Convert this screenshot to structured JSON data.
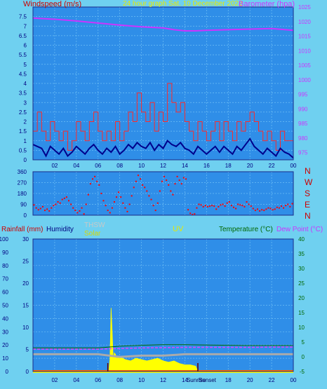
{
  "header": {
    "wind_title": "Windspeed (m/s)",
    "center_title": "24 hour graph Sat. 10 December 2022",
    "baro_title": "Barometer (hpa)"
  },
  "compass": [
    "N",
    "W",
    "S",
    "E",
    "N"
  ],
  "lower_labels": {
    "rain": "Rainfall (mm)",
    "humidity": "Humidity",
    "thsw": "THSW",
    "solar": "Solar",
    "uv": "UV",
    "temp": "Temperature (°C)",
    "dew": "Dew Point (°C)",
    "sunrise": "Sunrise",
    "sunset": "Sunset"
  },
  "colors": {
    "background": "#6fd0f0",
    "plot": "#2f8ee8",
    "grid": "#6fc0f5",
    "gust": "#ff2a2a",
    "wind": "#00008b",
    "barometer": "#cc33ff",
    "solar": "#ffff00",
    "temperature": "#ff0000",
    "dewpoint": "#dd44ff",
    "humidity": "#aaaaaa"
  },
  "chart_data": [
    {
      "type": "line",
      "name": "wind-barometer",
      "title": "24 hour graph Sat. 10 December 2022",
      "x_ticks": [
        "02",
        "04",
        "06",
        "08",
        "10",
        "12",
        "14",
        "16",
        "18",
        "20",
        "22",
        "00"
      ],
      "ylabel": "Windspeed (m/s)",
      "ylim": [
        0,
        8
      ],
      "y_ticks": [
        "0",
        "0.5",
        "1",
        "1.5",
        "2",
        "2.5",
        "3",
        "3.5",
        "4",
        "4.5",
        "5",
        "5.5",
        "6",
        "6.5",
        "7",
        "7.5"
      ],
      "y2label": "Barometer (hpa)",
      "y2lim": [
        972.5,
        1025
      ],
      "y2_ticks": [
        "975",
        "980",
        "985",
        "990",
        "995",
        "1000",
        "1005",
        "1010",
        "1015",
        "1020",
        "1025"
      ],
      "series": [
        {
          "name": "Gust",
          "color": "#ff2a2a",
          "style": "step",
          "x": [
            0.0,
            0.4,
            0.8,
            1.2,
            1.6,
            2.0,
            2.4,
            2.8,
            3.2,
            3.6,
            4.0,
            4.4,
            4.8,
            5.2,
            5.6,
            6.0,
            6.4,
            6.8,
            7.2,
            7.6,
            8.0,
            8.4,
            8.8,
            9.2,
            9.6,
            10.0,
            10.4,
            10.8,
            11.2,
            11.6,
            12.0,
            12.4,
            12.8,
            13.2,
            13.6,
            14.0,
            14.4,
            14.8,
            15.2,
            15.6,
            16.0,
            16.4,
            16.8,
            17.2,
            17.6,
            18.0,
            18.4,
            18.8,
            19.2,
            19.6,
            20.0,
            20.4,
            20.8,
            21.2,
            21.6,
            22.0,
            22.4,
            22.8,
            23.2,
            23.6,
            24.0
          ],
          "y": [
            1.5,
            2.5,
            1.5,
            1.0,
            2.0,
            1.5,
            1.0,
            1.5,
            0.5,
            1.0,
            2.0,
            1.5,
            1.0,
            2.0,
            2.5,
            1.5,
            1.0,
            1.5,
            1.0,
            2.0,
            1.0,
            1.5,
            2.5,
            2.0,
            3.5,
            2.5,
            2.0,
            3.0,
            1.5,
            2.5,
            2.0,
            4.0,
            3.0,
            2.5,
            3.0,
            2.0,
            1.5,
            1.0,
            2.0,
            1.5,
            1.0,
            1.5,
            2.0,
            1.0,
            2.0,
            1.5,
            1.0,
            2.0,
            1.5,
            2.0,
            2.5,
            2.0,
            1.5,
            1.0,
            1.5,
            1.0,
            0.5,
            1.5,
            1.0,
            1.0,
            0.5
          ]
        },
        {
          "name": "Wind",
          "color": "#00008b",
          "style": "line",
          "x": [
            0.0,
            0.4,
            0.8,
            1.2,
            1.6,
            2.0,
            2.4,
            2.8,
            3.2,
            3.6,
            4.0,
            4.4,
            4.8,
            5.2,
            5.6,
            6.0,
            6.4,
            6.8,
            7.2,
            7.6,
            8.0,
            8.4,
            8.8,
            9.2,
            9.6,
            10.0,
            10.4,
            10.8,
            11.2,
            11.6,
            12.0,
            12.4,
            12.8,
            13.2,
            13.6,
            14.0,
            14.4,
            14.8,
            15.2,
            15.6,
            16.0,
            16.4,
            16.8,
            17.2,
            17.6,
            18.0,
            18.4,
            18.8,
            19.2,
            19.6,
            20.0,
            20.4,
            20.8,
            21.2,
            21.6,
            22.0,
            22.4,
            22.8,
            23.2,
            23.6,
            24.0
          ],
          "y": [
            0.8,
            0.7,
            0.6,
            0.2,
            0.7,
            0.5,
            0.3,
            0.6,
            0.2,
            0.4,
            0.7,
            0.5,
            0.3,
            0.6,
            0.8,
            0.5,
            0.3,
            0.6,
            0.4,
            0.7,
            0.3,
            0.5,
            0.8,
            0.6,
            0.9,
            0.7,
            0.6,
            0.9,
            0.5,
            0.8,
            0.6,
            1.0,
            0.8,
            0.7,
            0.9,
            0.6,
            0.5,
            0.3,
            0.7,
            0.5,
            0.3,
            0.5,
            0.7,
            0.4,
            0.7,
            0.5,
            0.3,
            0.7,
            0.5,
            0.8,
            1.1,
            0.7,
            0.5,
            0.3,
            0.6,
            0.4,
            0.2,
            0.6,
            0.4,
            0.3,
            0.1
          ]
        },
        {
          "name": "Barometer",
          "axis": "y2",
          "color": "#cc33ff",
          "style": "line",
          "x": [
            0,
            2,
            4,
            6,
            8,
            10,
            12,
            13,
            14,
            15,
            16,
            18,
            20,
            22,
            24
          ],
          "y": [
            1021.2,
            1020.8,
            1020.2,
            1019.5,
            1018.8,
            1018.2,
            1017.8,
            1017.2,
            1016.8,
            1016.8,
            1017.0,
            1017.2,
            1017.4,
            1017.6,
            1017.0
          ]
        }
      ]
    },
    {
      "type": "scatter",
      "name": "wind-direction",
      "ylim": [
        0,
        360
      ],
      "y_ticks": [
        "0",
        "90",
        "180",
        "270",
        "360"
      ],
      "series": [
        {
          "name": "Direction",
          "color": "#ff0000",
          "x": [
            0.1,
            0.3,
            0.5,
            0.7,
            0.9,
            1.1,
            1.3,
            1.5,
            1.7,
            1.9,
            2.1,
            2.3,
            2.5,
            2.7,
            2.9,
            3.1,
            3.3,
            3.5,
            3.7,
            3.9,
            4.1,
            4.3,
            4.5,
            4.7,
            4.9,
            5.1,
            5.3,
            5.5,
            5.7,
            5.9,
            6.1,
            6.3,
            6.5,
            6.7,
            6.9,
            7.1,
            7.3,
            7.5,
            7.7,
            7.9,
            8.1,
            8.3,
            8.5,
            8.7,
            8.9,
            9.1,
            9.3,
            9.5,
            9.7,
            9.9,
            10.1,
            10.3,
            10.5,
            10.7,
            10.9,
            11.1,
            11.3,
            11.5,
            11.7,
            11.9,
            12.1,
            12.3,
            12.5,
            12.7,
            12.9,
            13.1,
            13.3,
            13.5,
            13.7,
            13.9,
            14.1,
            14.3,
            14.5,
            14.7,
            14.9,
            15.1,
            15.3,
            15.5,
            15.7,
            15.9,
            16.1,
            16.3,
            16.5,
            16.7,
            16.9,
            17.1,
            17.3,
            17.5,
            17.7,
            17.9,
            18.1,
            18.3,
            18.5,
            18.7,
            18.9,
            19.1,
            19.3,
            19.5,
            19.7,
            19.9,
            20.1,
            20.3,
            20.5,
            20.7,
            20.9,
            21.1,
            21.3,
            21.5,
            21.7,
            21.9,
            22.1,
            22.3,
            22.5,
            22.7,
            22.9,
            23.1,
            23.3,
            23.5,
            23.7,
            23.9
          ],
          "y": [
            85,
            60,
            45,
            55,
            70,
            40,
            50,
            35,
            60,
            80,
            90,
            110,
            100,
            130,
            140,
            150,
            120,
            90,
            60,
            40,
            20,
            35,
            60,
            10,
            90,
            170,
            260,
            300,
            320,
            280,
            250,
            180,
            120,
            80,
            40,
            20,
            60,
            110,
            150,
            190,
            150,
            100,
            60,
            30,
            90,
            160,
            230,
            280,
            330,
            300,
            250,
            230,
            200,
            160,
            130,
            80,
            40,
            100,
            200,
            280,
            320,
            290,
            250,
            200,
            170,
            260,
            320,
            290,
            260,
            310,
            300,
            45,
            15,
            5,
            10,
            60,
            90,
            85,
            70,
            80,
            70,
            75,
            80,
            75,
            50,
            70,
            85,
            90,
            75,
            100,
            110,
            80,
            65,
            55,
            90,
            85,
            80,
            70,
            110,
            90,
            75,
            55,
            40,
            50,
            35,
            45,
            40,
            50,
            60,
            55,
            45,
            50,
            65,
            60,
            75,
            60,
            80,
            90,
            70,
            95
          ]
        }
      ]
    },
    {
      "type": "area",
      "name": "rain-solar-temperature",
      "x_ticks": [
        "02",
        "04",
        "06",
        "08",
        "10",
        "12",
        "14",
        "16",
        "18",
        "20",
        "22",
        "00"
      ],
      "ylabel": "Rainfall (mm)",
      "ylim": [
        0,
        100
      ],
      "y_ticks": [
        "0",
        "10",
        "20",
        "30",
        "40",
        "50",
        "60",
        "70",
        "80",
        "90",
        "100"
      ],
      "y_mid_ticks": [
        "0",
        "5",
        "10",
        "15",
        "20",
        "25",
        "30"
      ],
      "y2label": "Temperature (°C)",
      "y2lim": [
        -5,
        40
      ],
      "y2_ticks": [
        "-5",
        "0",
        "5",
        "10",
        "15",
        "20",
        "25",
        "30",
        "35",
        "40"
      ],
      "sunrise_hour": 6.9,
      "sunset_hour": 15.2,
      "series": [
        {
          "name": "Solar",
          "color": "#ffff00",
          "style": "area",
          "x": [
            6.9,
            7.0,
            7.1,
            7.2,
            7.3,
            7.4,
            7.5,
            7.6,
            7.7,
            8.0,
            8.5,
            9.0,
            9.5,
            10.0,
            10.5,
            11.0,
            11.5,
            12.0,
            12.5,
            13.0,
            13.5,
            14.0,
            14.5,
            15.0,
            15.2
          ],
          "y": [
            0,
            1,
            10,
            48,
            30,
            8,
            14,
            13,
            10,
            11,
            9,
            8,
            10,
            9,
            8,
            9,
            10,
            8,
            7,
            8,
            6,
            5,
            5,
            4,
            0
          ]
        },
        {
          "name": "Temperature",
          "color": "#ff0000",
          "style": "line",
          "x": [
            0,
            6,
            7,
            8,
            10,
            12,
            14,
            16,
            18,
            20,
            22,
            24
          ],
          "y": [
            3.0,
            3.0,
            3.3,
            3.6,
            3.9,
            4.1,
            4.1,
            4.0,
            3.9,
            3.8,
            3.8,
            3.8
          ]
        },
        {
          "name": "Dew Point",
          "color": "#dd44ff",
          "style": "line",
          "x": [
            0,
            6,
            7,
            8,
            10,
            12,
            14,
            16,
            18,
            20,
            22,
            24
          ],
          "y": [
            2.6,
            2.6,
            2.7,
            2.8,
            3.0,
            3.1,
            3.2,
            3.2,
            3.2,
            3.2,
            3.3,
            3.3
          ]
        },
        {
          "name": "Humidity",
          "color": "#aaaaaa",
          "style": "line",
          "x": [
            0,
            6,
            7,
            8,
            10,
            12,
            14,
            16,
            18,
            20,
            22,
            24
          ],
          "y": [
            13,
            13,
            12,
            11,
            12,
            12,
            13,
            13,
            13,
            13,
            13,
            13
          ]
        },
        {
          "name": "Rainfall",
          "color": "#ff6600",
          "style": "line",
          "x": [
            0,
            24
          ],
          "y": [
            0,
            0
          ]
        }
      ]
    }
  ]
}
